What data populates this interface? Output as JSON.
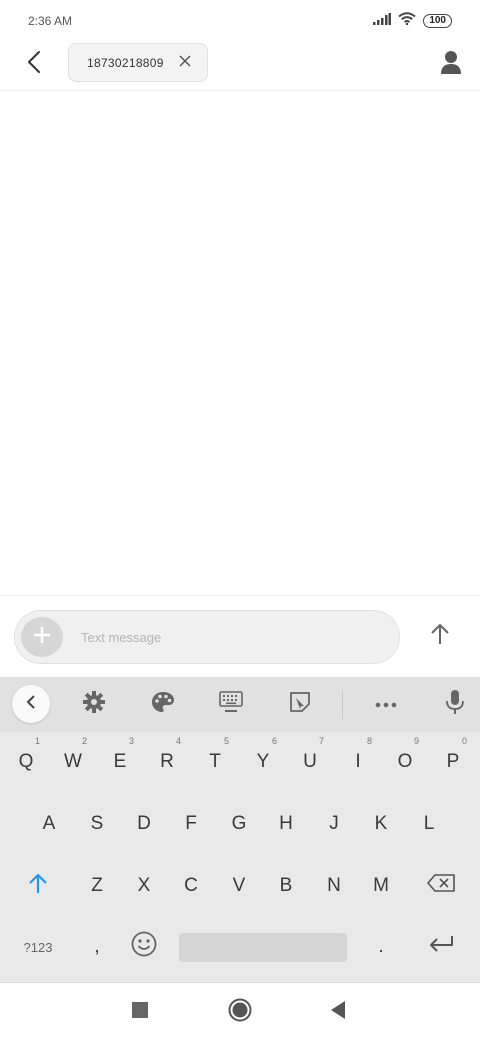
{
  "status_bar": {
    "time": "2:36 AM",
    "battery": "100",
    "icons": [
      "signal-icon",
      "wifi-icon",
      "battery-icon"
    ]
  },
  "header": {
    "recipient": "18730218809",
    "icons": [
      "back-arrow-icon",
      "close-icon",
      "contact-icon"
    ]
  },
  "composer": {
    "placeholder": "Text message",
    "icons": [
      "plus-icon",
      "send-arrow-icon"
    ]
  },
  "keyboard": {
    "toolbar_icons": [
      "chevron-left-icon",
      "gear-icon",
      "palette-icon",
      "keyboard-icon",
      "sticker-icon",
      "more-icon",
      "microphone-icon"
    ],
    "row1": [
      {
        "k": "Q",
        "hint": "1"
      },
      {
        "k": "W",
        "hint": "2"
      },
      {
        "k": "E",
        "hint": "3"
      },
      {
        "k": "R",
        "hint": "4"
      },
      {
        "k": "T",
        "hint": "5"
      },
      {
        "k": "Y",
        "hint": "6"
      },
      {
        "k": "U",
        "hint": "7"
      },
      {
        "k": "I",
        "hint": "8"
      },
      {
        "k": "O",
        "hint": "9"
      },
      {
        "k": "P",
        "hint": "0"
      }
    ],
    "row2": [
      "A",
      "S",
      "D",
      "F",
      "G",
      "H",
      "J",
      "K",
      "L"
    ],
    "row3": [
      "Z",
      "X",
      "C",
      "V",
      "B",
      "N",
      "M"
    ],
    "symbols_label": "?123",
    "comma": ",",
    "period": ".",
    "accent_color": "#2196f3"
  },
  "nav_bar": {
    "icons": [
      "recents-icon",
      "home-icon",
      "back-icon"
    ]
  }
}
